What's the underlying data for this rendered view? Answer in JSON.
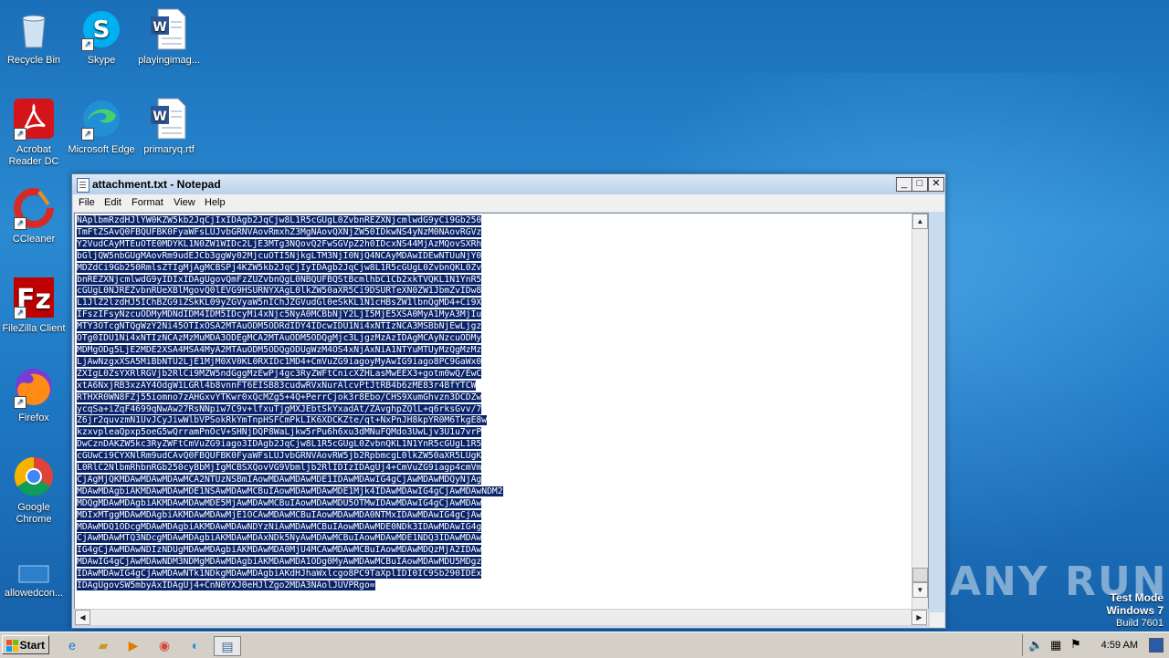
{
  "desktop": {
    "icons": [
      {
        "label": "Recycle Bin"
      },
      {
        "label": "Skype"
      },
      {
        "label": "playingimag..."
      },
      {
        "label": "Acrobat Reader DC"
      },
      {
        "label": "Microsoft Edge"
      },
      {
        "label": "primaryq.rtf"
      },
      {
        "label": "CCleaner"
      },
      {
        "label": "FileZilla Client"
      },
      {
        "label": "Firefox"
      },
      {
        "label": "Google Chrome"
      },
      {
        "label": "allowedcon..."
      }
    ]
  },
  "notepad": {
    "title": "attachment.txt - Notepad",
    "menu": [
      "File",
      "Edit",
      "Format",
      "View",
      "Help"
    ],
    "lines": [
      "NAplbmRzdHJlYW0KZW5kb2JqCjIxIDAgb2JqCjw8L1R5cGUgL0ZvbnREZXNjcmlwdG9yCi9Gb250",
      "TmFtZSAvQ0FBQUFBK0FyaWFsLUJvbGRNVAovRmxhZ3MgNAovQXNjZW50IDkwNS4yNzM0NAovRGVz",
      "Y2VudCAyMTEuOTE0MDYKL1N0ZW1WIDc2LjE3MTg3NQovQ2FwSGVpZ2h0IDcxNS44MjAzMQovSXRh",
      "bGljQW5nbGUgMAovRm9udEJCb3ggWy02MjcuOTI5NjkgLTM3NjI0NjQ4NCAyMDAwIDEwNTUuNjY0",
      "MDZdCi9Gb250RmlsZTIgMjAgMCBSPj4KZW5kb2JqCjIyIDAgb2JqCjw8L1R5cGUgL0ZvbnQKL0Zv",
      "bnREZXNjcmlwdG9yIDIxIDAgUgovQmFzZUZvbnQgL0NBQUFBQStBcmlhbC1Cb2xkTVQKL1N1YnR5",
      "cGUgL0NJREZvbnRUeXBlMgovQ0lEVG9HSURNYXAgL0lkZW50aXR5Ci9DSURTeXN0ZW1JbmZvIDw8",
      "L1JlZ2lzdHJ5IChBZG9iZSkKL09yZGVyaW5nIChJZGVudGl0eSkKL1N1cHBsZW1lbnQgMD4+Ci9X",
      "IFszIFsyNzcuODMyMDNdIDM4IDM5IDcyMi4xNjc5NyA0MCBbNjY2LjI5MjE5XSA0MyA1MyA3MjIu",
      "MTY3OTcgNTQgWzY2Ni45OTIxOSA2MTAuODM5ODRdIDY4IDcwIDU1Ni4xNTIzNCA3MSBbNjEwLjgz",
      "OTg0IDU1Ni4xNTIzNCAzMzMuMDA3ODEgMCA2MTAuODM5ODQgMjc3LjgzMzAzIDAgMCAyNzcuODMy",
      "MDMgODg5LjE2MDE2XSA4MSA4MyA2MTAuODM5ODQgODUgWzM4OS4xNjAxNiA1NTYuMTUyMzQgMzMz",
      "LjAwNzgxXSA5MiBbNTU2LjE1MjM0XV0KL0RXIDc1MD4+CmVuZG9iagoyMyAwIG9iago8PC9GaWx0",
      "ZXIgL0ZsYXRlRGVjb2RlCi9MZW5ndGggMzEwPj4gc3RyZWFtCnicXZHLasMwEEX3+gotm0wQ/EwC",
      "xtA6NxjRB3xzAY4OdgW1LGRl4b8vnnFT6EISB83cudwRVxNurAlcvPtJtRB4b6zME83r4BfYTCW",
      "RTHXR0WN8FZj55iomno7zAHGxvYTKwr0xQcMZg5+4Q+PerrCjok3r8Ebo/CHS9XumGhvzn3DCDZw",
      "ycqSa+iZqF4699qNwAw27RsNNpiw7C9v+lfxuTjgMXJEbtSkYxadAt/ZAvghpZQlL+q6rksGvv/7",
      "Z6jr2quvzmN1UvJCyJiwWlbVPSokRkYmTnpHSFCmPkLIK6XDCKZte/qt+NxPnJH8kpYR0M6TkgE8w",
      "kzxvpleaQpxp5oeG5wQrramPnOcV+SHNjDQP8WaLjkw5rPu6h6xu3dMNuFQMdo3UwLjv3U1u7vrP",
      "DwCznDAKZW5kc3RyZWFtCmVuZG9iago3IDAgb2JqCjw8L1R5cGUgL0ZvbnQKL1N1YnR5cGUgL1R5",
      "cGUwCi9CYXNlRm9udCAvQ0FBQUFBK0FyaWFsLUJvbGRNVAovRW5jb2RpbmcgL0lkZW50aXR5LUgK",
      "L0RlC2NlbmRhbnRGb250cyBbMjIgMCBSXQovVG9Vbmljb2RlIDIzIDAgUj4+CmVuZG9iagp4cmVm",
      "CjAgMjQKMDAwMDAwMDAwMCA2NTUzNSBmIAowMDAwMDAwMDE1IDAwMDAwIG4gCjAwMDAwMDQyNjAg",
      "MDAwMDAgbiAKMDAwMDAwMDE1NSAwMDAwMCBuIAowMDAwMDAwMDE1Mjk4IDAwMDAwIG4gCjAwMDAwNDM2",
      "MDQgMDAwMDAgbiAKMDAwMDAwMDE5MjAwMDAwMCBuIAowMDAwMDU5OTMwIDAwMDAwIG4gCjAwMDAw",
      "MDIxMTggMDAwMDAgbiAKMDAwMDAwMjE1OCAwMDAwMCBuIAowMDAwMDA0NTMxIDAwMDAwIG4gCjAw",
      "MDAwMDQ1ODcgMDAwMDAgbiAKMDAwMDAwNDYzNiAwMDAwMCBuIAowMDAwMDE0NDk3IDAwMDAwIG4g",
      "CjAwMDAwMTQ3NDcgMDAwMDAgbiAKMDAwMDAxNDk5NyAwMDAwMCBuIAowMDAwMDE1NDQ3IDAwMDAw",
      "IG4gCjAwMDAwNDIzNDUgMDAwMDAgbiAKMDAwMDA0MjU4MCAwMDAwMCBuIAowMDAwMDQzMjA2IDAw",
      "MDAwIG4gCjAwMDAwNDM3NDMgMDAwMDAgbiAKMDAwMDA1ODg0MyAwMDAwMCBuIAowMDAwMDU5MDgz",
      "IDAwMDAwIG4gCjAwMDAwNTk1NDkgMDAwMDAgbiAKdHJhaWxlcgo8PC9TaXplIDI0IC9Sb290IDEx",
      "IDAgUgovSW5mbyAxIDAgUj4+CnN0YXJ0eHJlZgo2MDA3NAolJUVPRgo="
    ]
  },
  "watermark": {
    "text": "ANY RUN"
  },
  "sysinfo": {
    "line1": "Test Mode",
    "line2": "Windows 7",
    "line3": "Build 7601"
  },
  "taskbar": {
    "start_label": "Start",
    "clock": "4:59 AM"
  }
}
